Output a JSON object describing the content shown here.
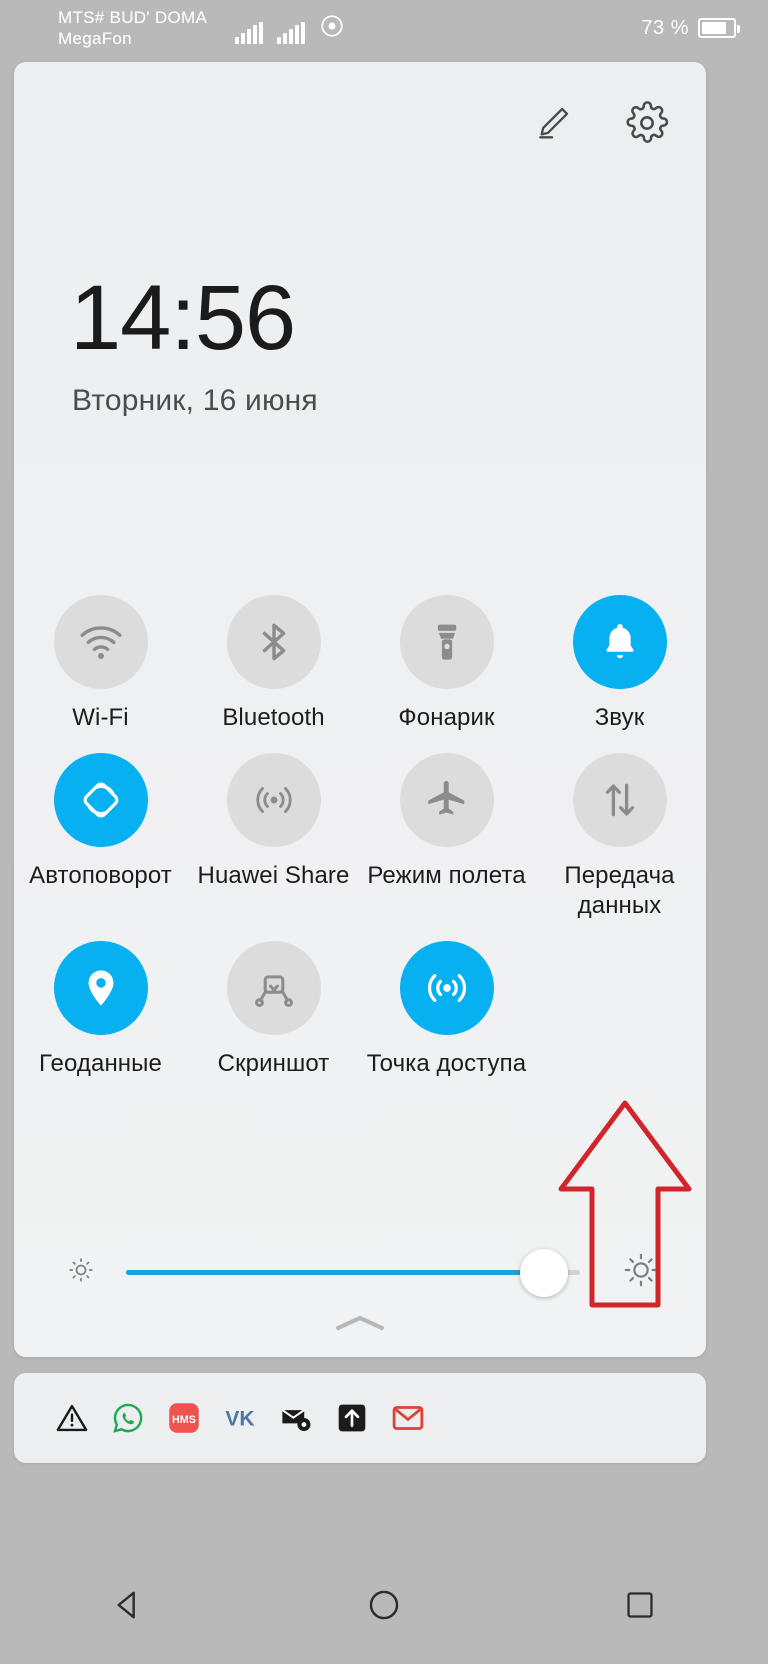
{
  "statusbar": {
    "carrier_line1": "MTS# BUD' DOMA",
    "carrier_line2": "MegaFon",
    "signal_icon_1": "signal-bars-icon",
    "signal_icon_2": "signal-bars-icon",
    "signal_icon_3": "nfc-icon",
    "battery_percent": "73 %",
    "battery_icon": "battery-icon",
    "battery_level": 73
  },
  "shade": {
    "edit_icon": "pencil-edit-icon",
    "settings_icon": "gear-icon",
    "clock": "14:56",
    "date": "Вторник, 16 июня",
    "collapse_icon": "chevron-up-icon"
  },
  "toggles": [
    {
      "label": "Wi-Fi",
      "icon": "wifi-icon",
      "active": false
    },
    {
      "label": "Bluetooth",
      "icon": "bluetooth-icon",
      "active": false
    },
    {
      "label": "Фонарик",
      "icon": "flashlight-icon",
      "active": false
    },
    {
      "label": "Звук",
      "icon": "bell-icon",
      "active": true
    },
    {
      "label": "Автоповорот",
      "icon": "auto-rotate-icon",
      "active": true
    },
    {
      "label": "Huawei Share",
      "icon": "huawei-share-icon",
      "active": false
    },
    {
      "label": "Режим полета",
      "icon": "airplane-icon",
      "active": false
    },
    {
      "label": "Передача данных",
      "icon": "data-transfer-icon",
      "active": false
    },
    {
      "label": "Геоданные",
      "icon": "location-pin-icon",
      "active": true
    },
    {
      "label": "Скриншот",
      "icon": "screenshot-icon",
      "active": false
    },
    {
      "label": "Точка доступа",
      "icon": "hotspot-icon",
      "active": true
    }
  ],
  "brightness": {
    "low_icon": "brightness-low-icon",
    "high_icon": "brightness-high-icon",
    "value": 92
  },
  "notifications": {
    "icons": [
      "warning-triangle-icon",
      "whatsapp-icon",
      "hms-icon",
      "vk-icon",
      "mail-settings-icon",
      "upload-arrow-icon",
      "gmail-icon"
    ]
  },
  "navbar": {
    "back_icon": "back-triangle-icon",
    "home_icon": "home-circle-icon",
    "recents_icon": "recents-square-icon"
  },
  "annotation": {
    "shape": "red-arrow-up",
    "color": "#d0252b"
  },
  "colors": {
    "accent": "#07b0f0",
    "slider": "#1ba3d8",
    "panel": "#eceef0",
    "system_gray": "#b9b9b9",
    "inactive_knob": "#dcdcdc"
  }
}
